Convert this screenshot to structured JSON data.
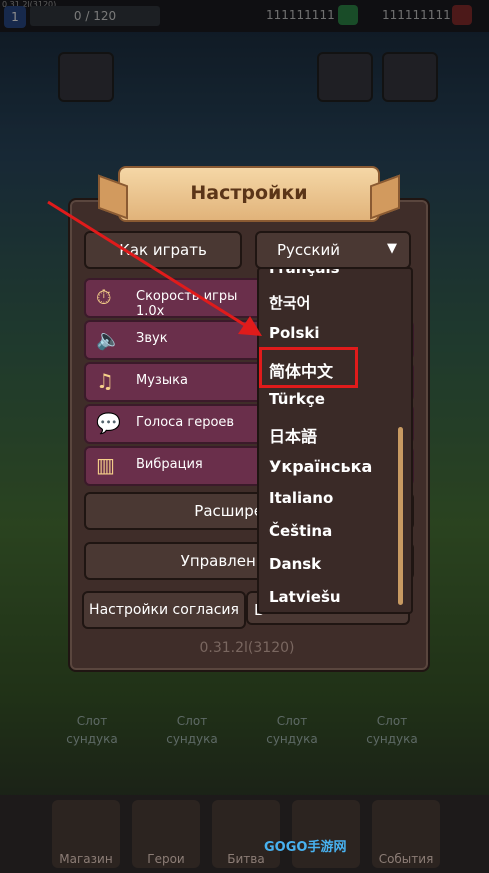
{
  "status": {
    "version_tiny": "0.31.2l(3120)",
    "level": "1",
    "xp": "0 / 120",
    "gold": "111111111",
    "gems": "111111111"
  },
  "title": "Настройки",
  "buttons": {
    "how_to_play": "Как играть",
    "advanced": "Расширенные",
    "online": "Управление онла",
    "consent": "Настройки согласия",
    "consent_right": "В"
  },
  "settings": [
    {
      "label": "Скорость игры 1.0x",
      "icon": "stopwatch-icon"
    },
    {
      "label": "Звук",
      "icon": "speaker-icon"
    },
    {
      "label": "Музыка",
      "icon": "music-note-icon"
    },
    {
      "label": "Голоса героев",
      "icon": "speech-bubble-icon"
    },
    {
      "label": "Вибрация",
      "icon": "vibration-icon"
    }
  ],
  "language": {
    "selected": "Русский",
    "options": [
      "Français",
      "한국어",
      "Polski",
      "简体中文",
      "Türkçe",
      "日本語",
      "Українська",
      "Italiano",
      "Čeština",
      "Dansk",
      "Latviešu"
    ]
  },
  "version": "0.31.2l(3120)",
  "slots": [
    "Слот сундука",
    "Слот сундука",
    "Слот сундука",
    "Слот сундука"
  ],
  "tabs": [
    "Магазин",
    "Герои",
    "Битва",
    "",
    "События"
  ],
  "watermark": "GOGO手游网",
  "colors": {
    "highlight": "#e01b1b",
    "row": "#6a2f4b",
    "ribbon": "#e1b37a"
  }
}
